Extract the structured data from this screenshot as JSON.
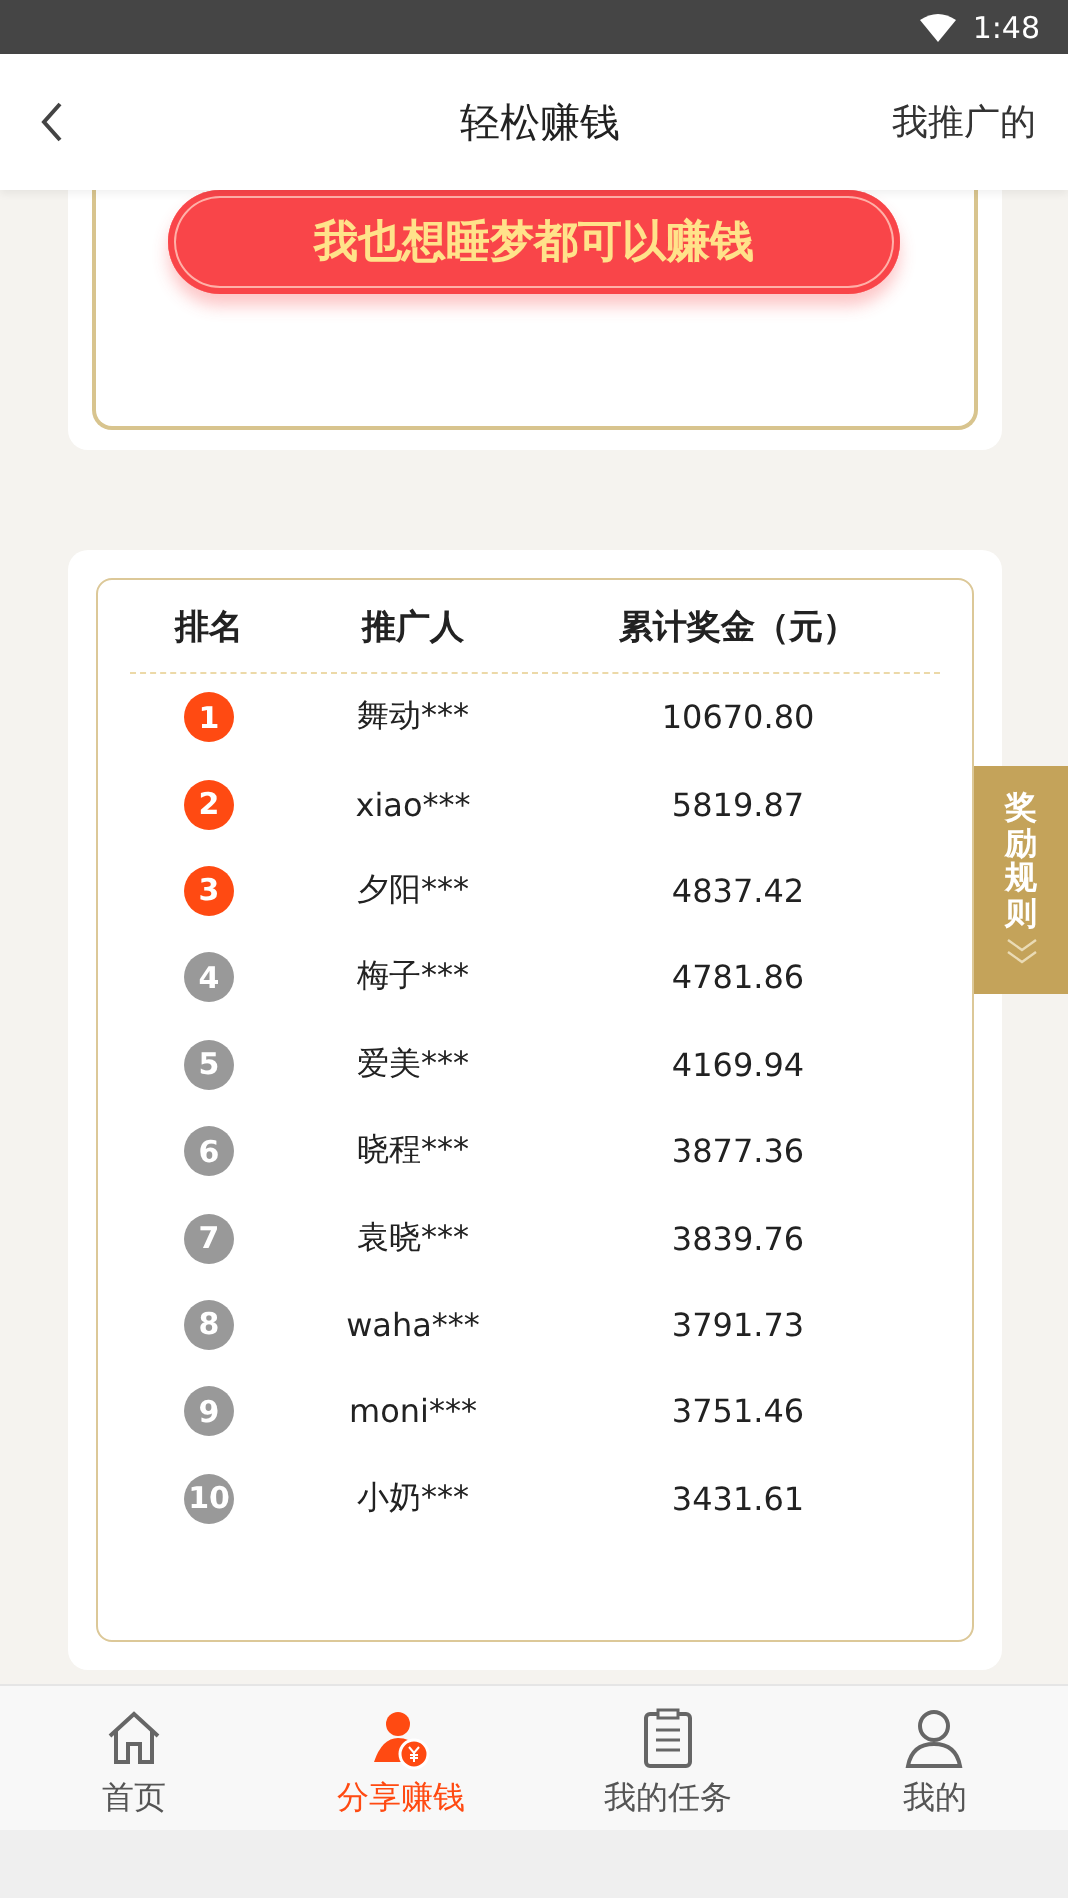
{
  "status_bar": {
    "time": "1:48"
  },
  "header": {
    "title": "轻松赚钱",
    "action": "我推广的"
  },
  "promo_button": {
    "label": "我也想睡梦都可以赚钱"
  },
  "ranking": {
    "columns": [
      "排名",
      "推广人",
      "累计奖金（元）"
    ],
    "rows": [
      {
        "rank": "1",
        "name": "舞动***",
        "amount": "10670.80",
        "color": "#ff4a12"
      },
      {
        "rank": "2",
        "name": "xiao***",
        "amount": "5819.87",
        "color": "#ff4a12"
      },
      {
        "rank": "3",
        "name": "夕阳***",
        "amount": "4837.42",
        "color": "#ff4a12"
      },
      {
        "rank": "4",
        "name": "梅子***",
        "amount": "4781.86",
        "color": "#999999"
      },
      {
        "rank": "5",
        "name": "爱美***",
        "amount": "4169.94",
        "color": "#999999"
      },
      {
        "rank": "6",
        "name": "晓程***",
        "amount": "3877.36",
        "color": "#999999"
      },
      {
        "rank": "7",
        "name": "袁晓***",
        "amount": "3839.76",
        "color": "#999999"
      },
      {
        "rank": "8",
        "name": "waha***",
        "amount": "3791.73",
        "color": "#999999"
      },
      {
        "rank": "9",
        "name": "moni***",
        "amount": "3751.46",
        "color": "#999999"
      },
      {
        "rank": "10",
        "name": "小奶***",
        "amount": "3431.61",
        "color": "#999999"
      }
    ]
  },
  "side_tab": {
    "label": "奖励规则"
  },
  "bottom_nav": [
    {
      "label": "首页",
      "selected": false
    },
    {
      "label": "分享赚钱",
      "selected": true
    },
    {
      "label": "我的任务",
      "selected": false
    },
    {
      "label": "我的",
      "selected": false
    }
  ]
}
